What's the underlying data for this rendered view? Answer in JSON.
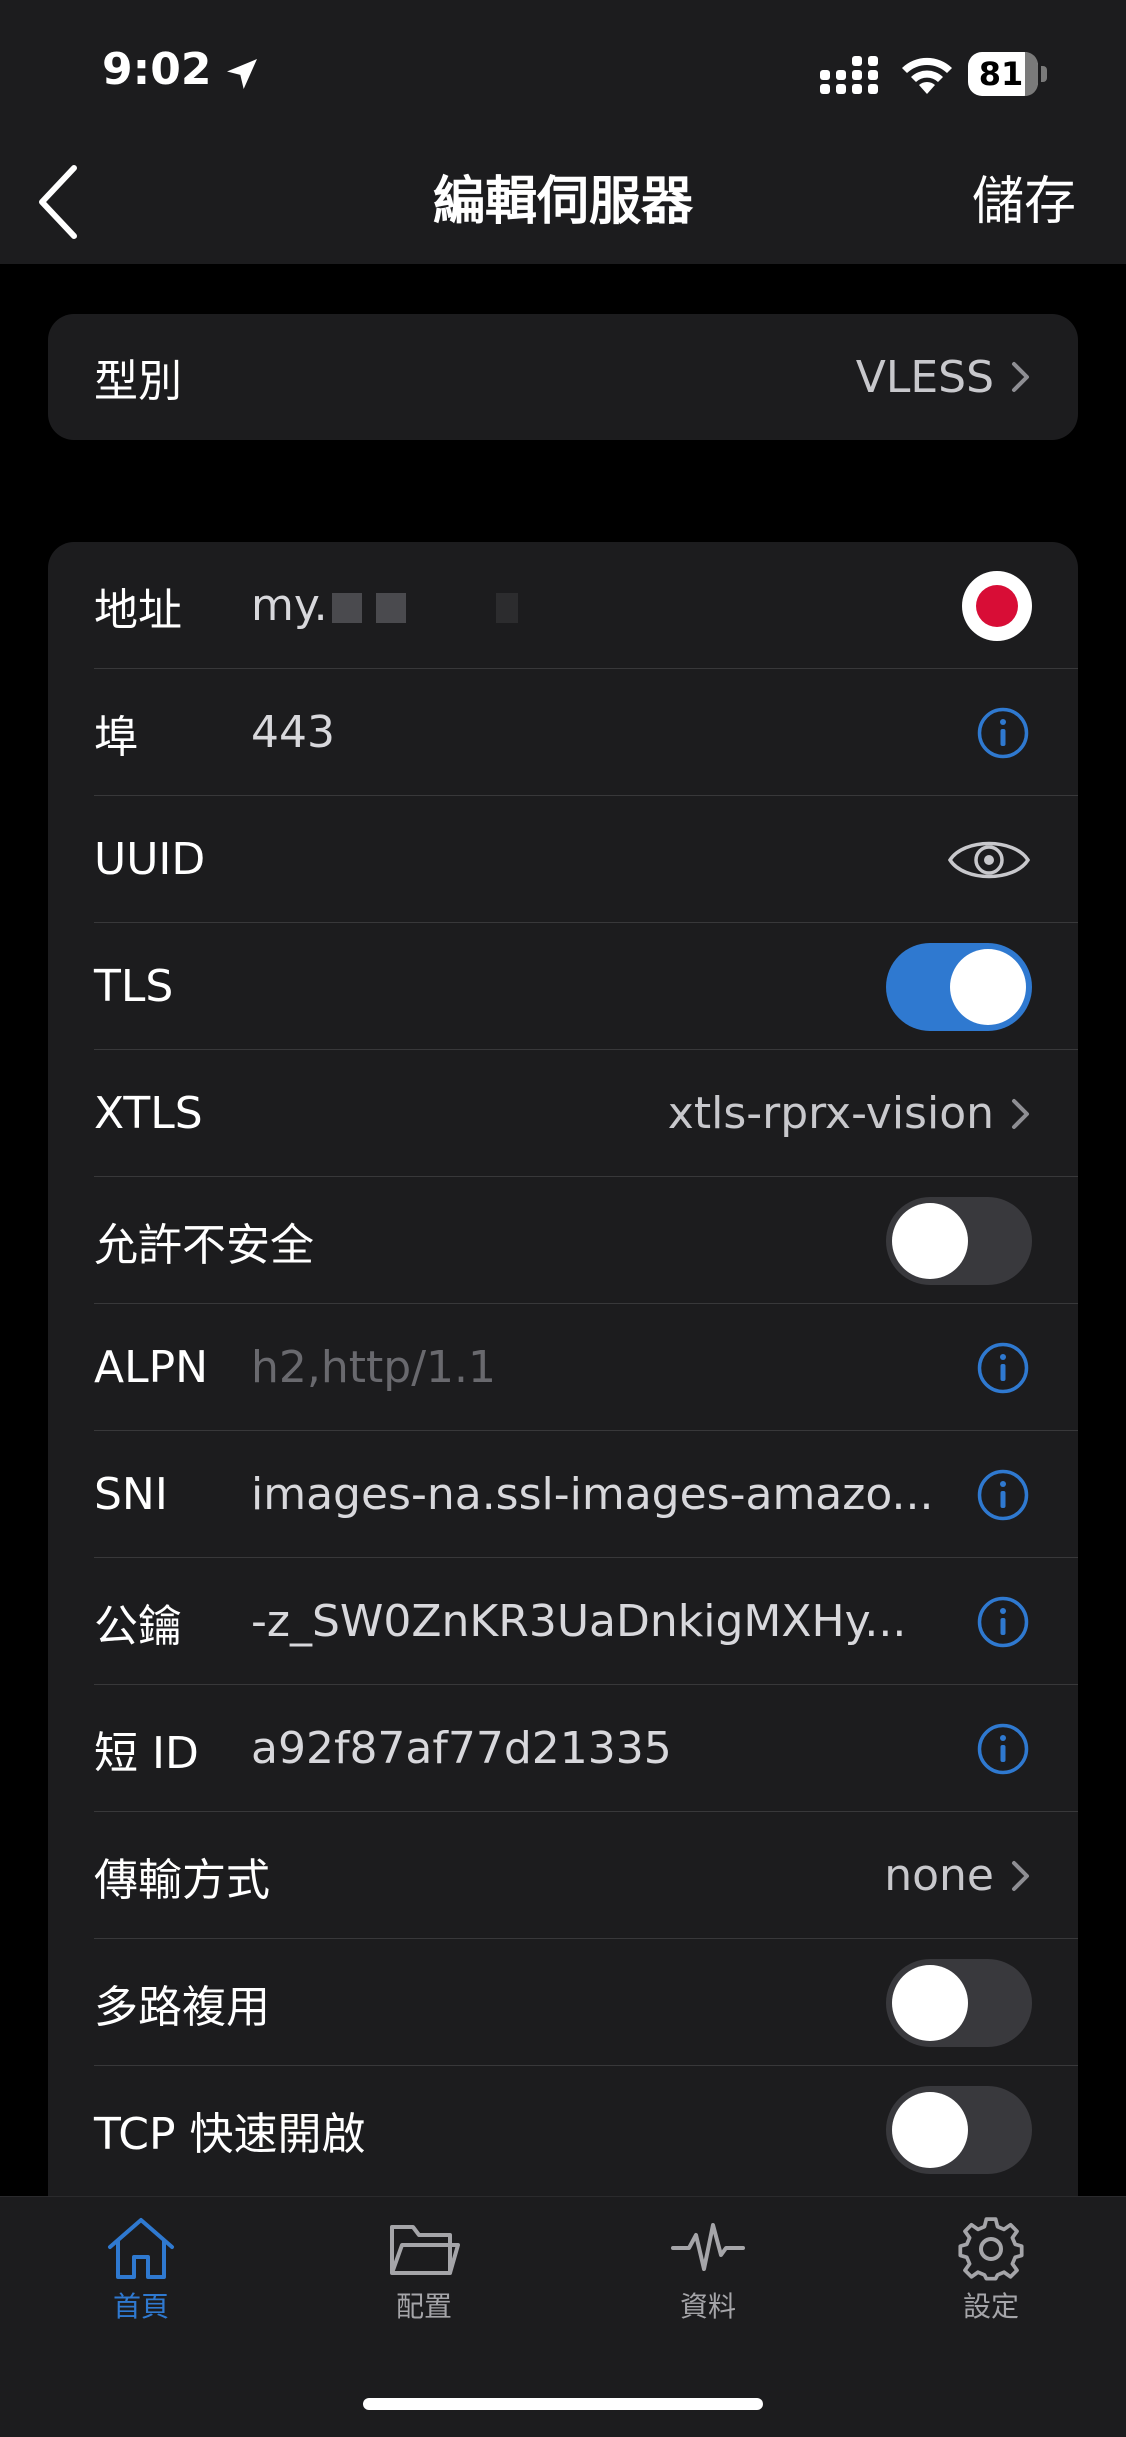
{
  "status_bar": {
    "time": "9:02",
    "battery": "81",
    "battery_level": 0.81
  },
  "nav": {
    "title": "編輯伺服器",
    "save_label": "儲存"
  },
  "type_row": {
    "label": "型別",
    "value": "VLESS"
  },
  "fields": {
    "address": {
      "label": "地址",
      "value": "my."
    },
    "port": {
      "label": "埠",
      "value": "443"
    },
    "uuid": {
      "label": "UUID"
    },
    "tls": {
      "label": "TLS",
      "on": true
    },
    "xtls": {
      "label": "XTLS",
      "value": "xtls-rprx-vision"
    },
    "allow_insecure": {
      "label": "允許不安全",
      "on": false
    },
    "alpn": {
      "label": "ALPN",
      "placeholder": "h2,http/1.1"
    },
    "sni": {
      "label": "SNI",
      "value": "images-na.ssl-images-amazo..."
    },
    "public_key": {
      "label": "公鑰",
      "value": "-z_SW0ZnKR3UaDnkigMXHy..."
    },
    "short_id": {
      "label": "短 ID",
      "value": "a92f87af77d21335"
    },
    "transport": {
      "label": "傳輸方式",
      "value": "none"
    },
    "mux": {
      "label": "多路複用",
      "on": false
    },
    "tcp_fast_open": {
      "label": "TCP 快速開啟",
      "on": false
    }
  },
  "tabs": [
    {
      "label": "首頁",
      "icon": "home-icon",
      "active": true
    },
    {
      "label": "配置",
      "icon": "folder-icon",
      "active": false
    },
    {
      "label": "資料",
      "icon": "activity-icon",
      "active": false
    },
    {
      "label": "設定",
      "icon": "gear-icon",
      "active": false
    }
  ],
  "colors": {
    "accent": "#2f79d0",
    "record": "#d80d36",
    "background": "#000000",
    "card": "#1c1c1e"
  }
}
